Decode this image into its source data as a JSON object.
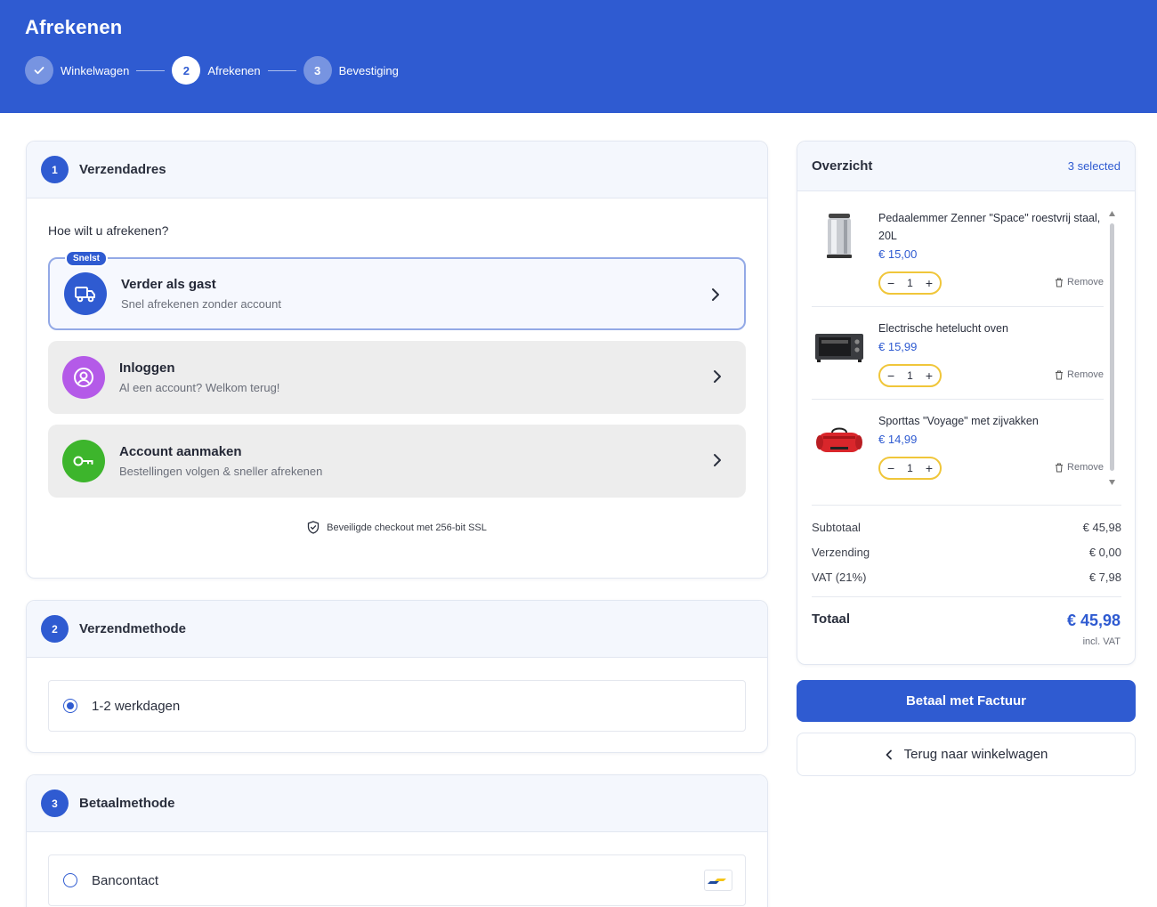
{
  "header": {
    "title": "Afrekenen",
    "steps": [
      {
        "label": "Winkelwagen",
        "number": "",
        "state": "done"
      },
      {
        "label": "Afrekenen",
        "number": "2",
        "state": "active"
      },
      {
        "label": "Bevestiging",
        "number": "3",
        "state": "todo"
      }
    ]
  },
  "shipping_address": {
    "number": "1",
    "title": "Verzendadres",
    "question": "Hoe wilt u afrekenen?",
    "options": [
      {
        "badge": "Snelst",
        "title": "Verder als gast",
        "subtitle": "Snel afrekenen zonder account",
        "icon": "truck-icon",
        "color": "#2f5bd1"
      },
      {
        "title": "Inloggen",
        "subtitle": "Al een account? Welkom terug!",
        "icon": "user-circle-icon",
        "color": "#b45ae8"
      },
      {
        "title": "Account aanmaken",
        "subtitle": "Bestellingen volgen & sneller afrekenen",
        "icon": "key-icon",
        "color": "#3db52c"
      }
    ],
    "secure_note": "Beveiligde checkout met 256-bit SSL"
  },
  "shipping_method": {
    "number": "2",
    "title": "Verzendmethode",
    "options": [
      {
        "label": "1-2 werkdagen",
        "selected": true
      }
    ]
  },
  "payment_method": {
    "number": "3",
    "title": "Betaalmethode",
    "options": [
      {
        "label": "Bancontact",
        "selected": false
      }
    ]
  },
  "summary": {
    "title": "Overzicht",
    "selected_count": "3 selected",
    "items": [
      {
        "name": "Pedaalemmer Zenner \"Space\" roestvrij staal, 20L",
        "price": "€ 15,00",
        "qty": "1",
        "remove": "Remove",
        "image": "trash-bin-image"
      },
      {
        "name": "Electrische hetelucht oven",
        "price": "€ 15,99",
        "qty": "1",
        "remove": "Remove",
        "image": "oven-image"
      },
      {
        "name": "Sporttas \"Voyage\" met zijvakken",
        "price": "€ 14,99",
        "qty": "1",
        "remove": "Remove",
        "image": "sports-bag-image"
      }
    ],
    "subtotal_label": "Subtotaal",
    "subtotal": "€ 45,98",
    "shipping_label": "Verzending",
    "shipping": "€ 0,00",
    "vat_label": "VAT (21%)",
    "vat": "€ 7,98",
    "total_label": "Totaal",
    "total": "€ 45,98",
    "incl_vat": "incl. VAT"
  },
  "actions": {
    "pay": "Betaal met Factuur",
    "back": "Terug naar winkelwagen"
  },
  "colors": {
    "primary": "#2f5bd1",
    "accent_yellow": "#f0c63a"
  }
}
